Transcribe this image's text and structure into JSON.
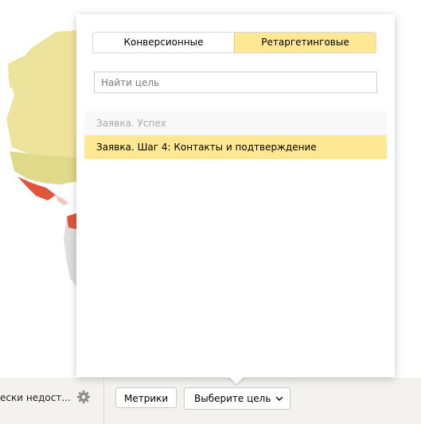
{
  "goal_popup": {
    "tabs": [
      {
        "label": "Конверсионные",
        "active": false
      },
      {
        "label": "Ретаргетинговые",
        "active": true
      }
    ],
    "search": {
      "placeholder": "Найти цель",
      "value": ""
    },
    "goals": [
      {
        "label": "Заявка. Успех",
        "state": "disabled"
      },
      {
        "label": "Заявка. Шаг 4: Контакты и подтверждение",
        "state": "selected"
      }
    ]
  },
  "bottom_bar": {
    "truncated_text": "ески недост...",
    "metrics_button": "Метрики",
    "goal_button": "Выберите цель"
  },
  "colors": {
    "accent_yellow": "#ffe793",
    "map_light": "#ede39a",
    "map_green": "#dfd98a",
    "map_red": "#e2553b"
  }
}
